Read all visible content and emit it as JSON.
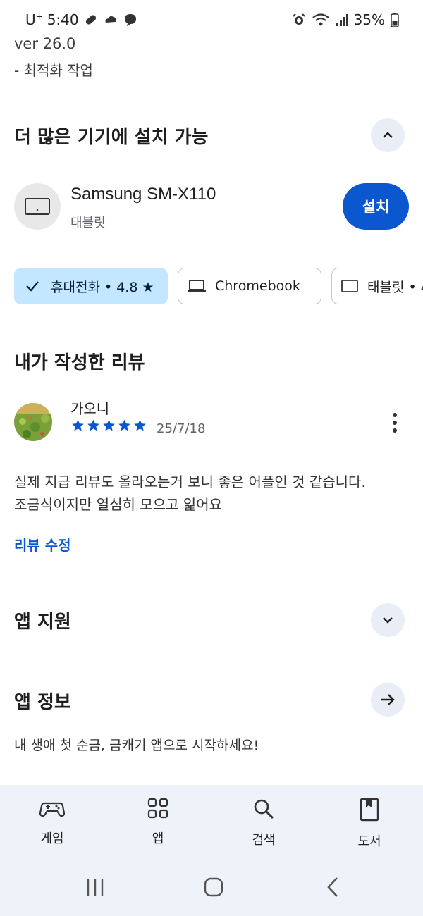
{
  "status_bar": {
    "carrier": "U",
    "carrier_sup": "+",
    "time": "5:40",
    "battery": "35%"
  },
  "whats_new": {
    "version": "ver 26.0",
    "change": "- 최적화 작업"
  },
  "devices_section": {
    "title": "더 많은 기기에 설치 가능",
    "device_name": "Samsung SM-X110",
    "device_type": "태블릿",
    "install_label": "설치",
    "chips": [
      {
        "label": "휴대전화 • 4.8 ★",
        "selected": true
      },
      {
        "label": "Chromebook",
        "selected": false
      },
      {
        "label": "태블릿 • 4",
        "selected": false
      }
    ]
  },
  "my_review": {
    "title": "내가 작성한 리뷰",
    "reviewer": "가오니",
    "rating": 5,
    "date": "25/7/18",
    "text_line1": "실제 지급 리뷰도 올라오는거 보니 좋은 어플인 것 같습니다.",
    "text_line2": "조금식이지만 열심히 모으고 잁어요",
    "edit_label": "리뷰 수정"
  },
  "app_support": {
    "title": "앱 지원"
  },
  "app_info": {
    "title": "앱 정보",
    "description": "내 생애 첫 순금, 금캐기 앱으로 시작하세요!"
  },
  "bottom_nav": {
    "items": [
      {
        "label": "게임",
        "icon": "gamepad-icon"
      },
      {
        "label": "앱",
        "icon": "apps-grid-icon"
      },
      {
        "label": "검색",
        "icon": "search-icon"
      },
      {
        "label": "도서",
        "icon": "book-icon"
      }
    ]
  },
  "colors": {
    "accent": "#0b57d0",
    "chip_selected": "#c2e7ff",
    "nav_bg": "#eef2f9"
  }
}
